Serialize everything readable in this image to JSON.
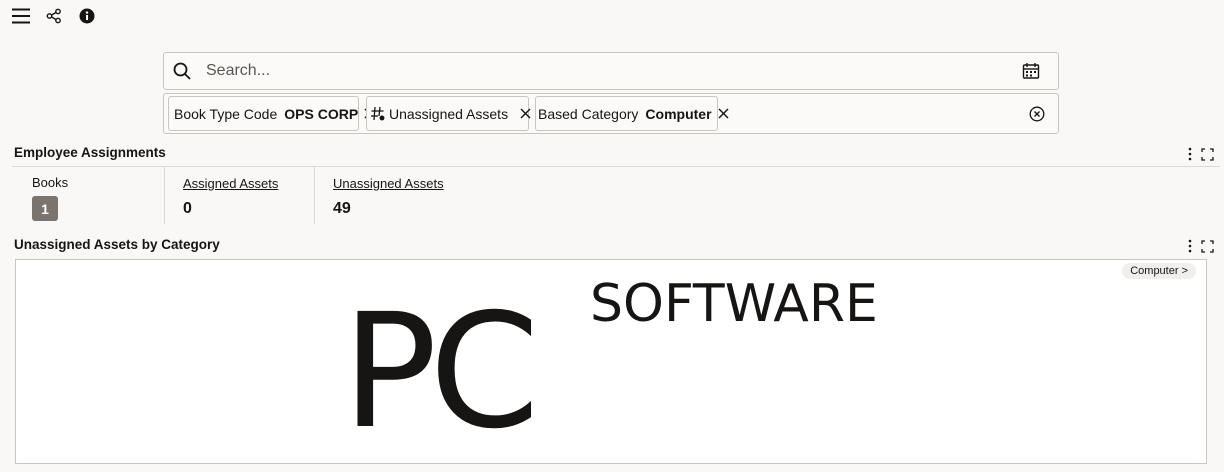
{
  "toolbar": {
    "icons": [
      "hamburger-menu-icon",
      "share-icon",
      "info-icon"
    ]
  },
  "search": {
    "placeholder": "Search...",
    "value": ""
  },
  "filters": {
    "chips": [
      {
        "key": "Book Type Code",
        "value": "OPS CORP"
      },
      {
        "key": "Unassigned Assets",
        "value": ""
      },
      {
        "key": "Based Category",
        "value": "Computer"
      }
    ]
  },
  "employee_assignments": {
    "title": "Employee Assignments",
    "metrics": [
      {
        "label": "Books",
        "value": "1"
      },
      {
        "label": "Assigned Assets",
        "value": "0"
      },
      {
        "label": "Unassigned Assets",
        "value": "49"
      }
    ]
  },
  "unassigned_by_category": {
    "title": "Unassigned Assets by Category",
    "breadcrumb": "Computer >",
    "words": [
      "PC",
      "SOFTWARE"
    ]
  },
  "colors": {
    "background": "#f9f8f6",
    "text": "#161513",
    "border": "#c9c6c0",
    "badge": "#7a736e"
  }
}
